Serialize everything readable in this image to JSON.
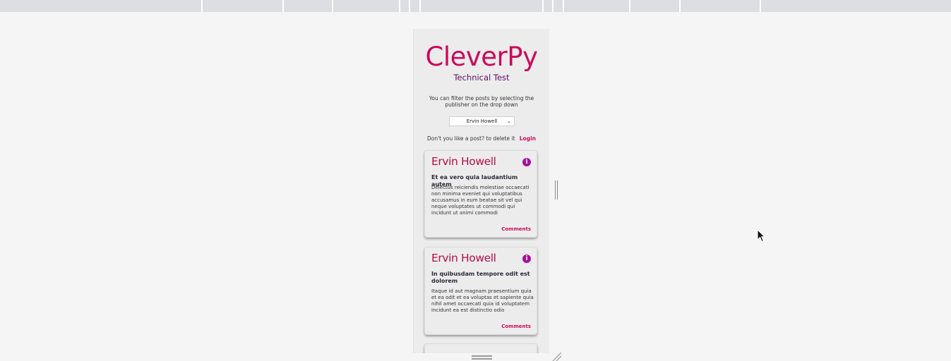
{
  "app": {
    "logo_text": "CleverPy",
    "subtitle": "Technical Test",
    "filter_hint": "You can filter the posts by selecting the publisher on the drop down",
    "publisher_select": {
      "selected": "Ervin Howell",
      "chevron": "⌄"
    },
    "delete_prompt": "Don't you like a post? to delete it",
    "login_label": "Login"
  },
  "posts": [
    {
      "author": "Ervin Howell",
      "title": "Et ea vero quia laudantium autem",
      "body": "Delectus reiciendis molestiae occaecati non minima eveniet qui voluptatibus accusamus in eum beatae sit vel qui neque voluptates ut commodi qui incidunt ut animi commodi",
      "comments_label": "Comments",
      "info_icon": "i"
    },
    {
      "author": "Ervin Howell",
      "title": "In quibusdam tempore odit est dolorem",
      "body": "Itaque id aut magnam praesentium quia et ea odit et ea voluptas et sapiente quia nihil amet occaecati quia id voluptatem incidunt ea est distinctio odio",
      "comments_label": "Comments",
      "info_icon": "i"
    }
  ],
  "colors": {
    "brand": "#cc0a5a",
    "subtitle": "#5c0f63",
    "info_icon": "#a4139e"
  }
}
